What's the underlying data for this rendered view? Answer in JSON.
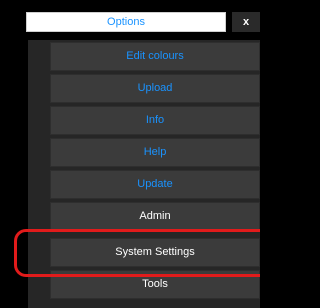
{
  "header": {
    "title": "Options",
    "close_label": "x"
  },
  "menu": {
    "items": [
      {
        "label": "Edit colours",
        "color": "#1a93ff"
      },
      {
        "label": "Upload",
        "color": "#1a93ff"
      },
      {
        "label": "Info",
        "color": "#1a93ff"
      },
      {
        "label": "Help",
        "color": "#1a93ff"
      },
      {
        "label": "Update",
        "color": "#1a93ff"
      },
      {
        "label": "Admin",
        "color": "#ffffff"
      },
      {
        "label": "System Settings",
        "color": "#ffffff",
        "highlighted": true
      },
      {
        "label": "Tools",
        "color": "#ffffff"
      }
    ]
  },
  "highlight_color": "#e11b1b"
}
